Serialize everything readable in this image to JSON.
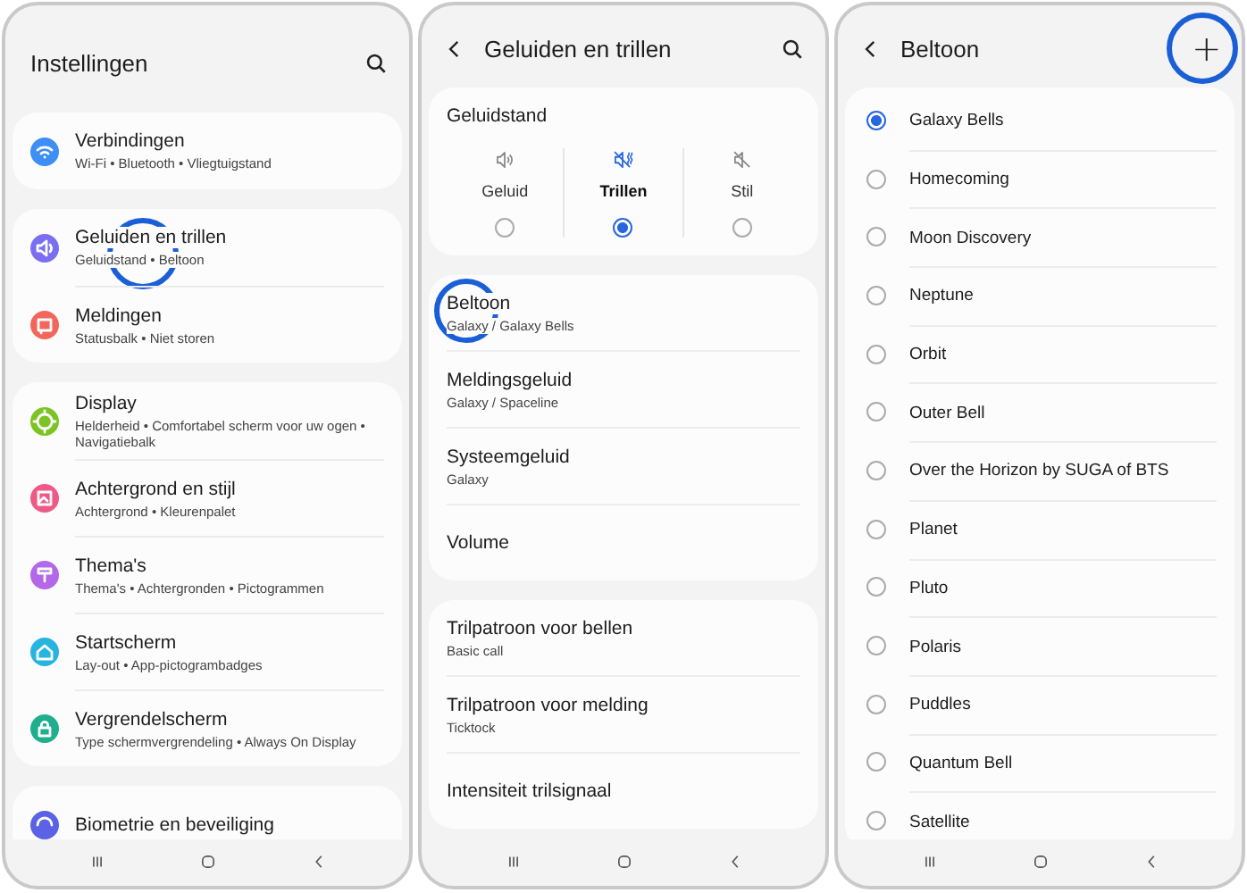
{
  "screens": [
    {
      "kind": "settings",
      "title": "Instellingen",
      "groups": [
        [
          {
            "title": "Verbindingen",
            "subtitle": "Wi-Fi  •  Bluetooth  •  Vliegtuigstand",
            "color": "#3d8ef5",
            "highlighted": false
          }
        ],
        [
          {
            "title": "Geluiden en trillen",
            "subtitle": "Geluidstand  •  Beltoon",
            "color": "#7a6ff0",
            "highlighted": true
          },
          {
            "title": "Meldingen",
            "subtitle": "Statusbalk  •  Niet storen",
            "color": "#f2665c",
            "highlighted": false
          }
        ],
        [
          {
            "title": "Display",
            "subtitle": "Helderheid  •  Comfortabel scherm voor uw ogen  •  Navigatiebalk",
            "color": "#7cc423",
            "highlighted": false
          },
          {
            "title": "Achtergrond en stijl",
            "subtitle": "Achtergrond  •  Kleurenpalet",
            "color": "#ee5a86",
            "highlighted": false
          },
          {
            "title": "Thema's",
            "subtitle": "Thema's  •  Achtergronden  •  Pictogrammen",
            "color": "#b268e8",
            "highlighted": false
          },
          {
            "title": "Startscherm",
            "subtitle": "Lay-out  •  App-pictogrambadges",
            "color": "#27b4e0",
            "highlighted": false
          },
          {
            "title": "Vergrendelscherm",
            "subtitle": "Type schermvergrendeling  •  Always On Display",
            "color": "#1fae8e",
            "highlighted": false
          }
        ],
        [
          {
            "title": "Biometrie en beveiliging",
            "color": "#5a62e6",
            "highlighted": false
          }
        ]
      ]
    },
    {
      "kind": "sounds",
      "title": "Geluiden en trillen",
      "mode_card": {
        "title": "Geluidstand",
        "modes": [
          {
            "label": "Geluid",
            "selected": false
          },
          {
            "label": "Trillen",
            "selected": true
          },
          {
            "label": "Stil",
            "selected": false
          }
        ]
      },
      "groups": [
        [
          {
            "title": "Beltoon",
            "subtitle": "Galaxy / Galaxy Bells",
            "highlighted": true
          },
          {
            "title": "Meldingsgeluid",
            "subtitle": "Galaxy / Spaceline",
            "highlighted": false
          },
          {
            "title": "Systeemgeluid",
            "subtitle": "Galaxy",
            "highlighted": false
          },
          {
            "title": "Volume",
            "highlighted": false
          }
        ],
        [
          {
            "title": "Trilpatroon voor bellen",
            "subtitle": "Basic call",
            "highlighted": false
          },
          {
            "title": "Trilpatroon voor melding",
            "subtitle": "Ticktock",
            "highlighted": false
          },
          {
            "title": "Intensiteit trilsignaal",
            "highlighted": false
          }
        ]
      ]
    },
    {
      "kind": "ringtones",
      "title": "Beltoon",
      "add_button": {
        "label": "+",
        "highlighted": true
      },
      "ringtones": [
        {
          "name": "Galaxy Bells",
          "selected": true
        },
        {
          "name": "Homecoming",
          "selected": false
        },
        {
          "name": "Moon Discovery",
          "selected": false
        },
        {
          "name": "Neptune",
          "selected": false
        },
        {
          "name": "Orbit",
          "selected": false
        },
        {
          "name": "Outer Bell",
          "selected": false
        },
        {
          "name": "Over the Horizon by SUGA of BTS",
          "selected": false
        },
        {
          "name": "Planet",
          "selected": false
        },
        {
          "name": "Pluto",
          "selected": false
        },
        {
          "name": "Polaris",
          "selected": false
        },
        {
          "name": "Puddles",
          "selected": false
        },
        {
          "name": "Quantum Bell",
          "selected": false
        },
        {
          "name": "Satellite",
          "selected": false
        }
      ]
    }
  ]
}
